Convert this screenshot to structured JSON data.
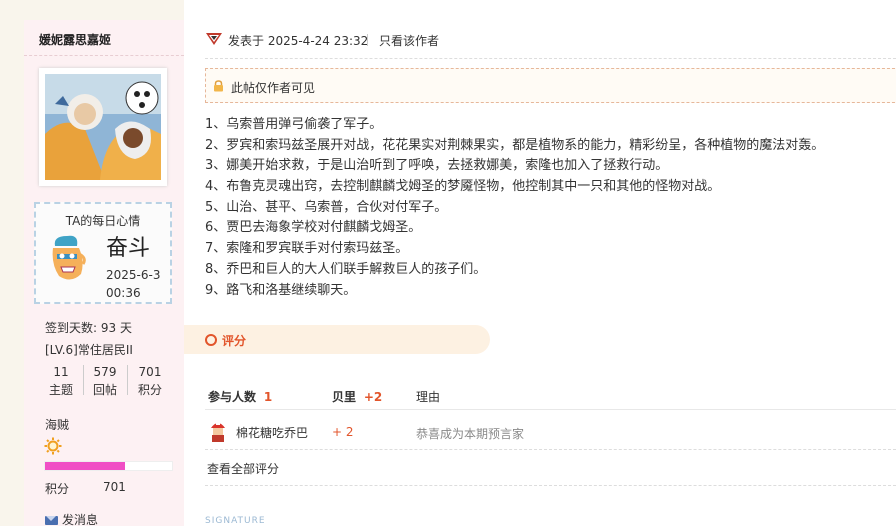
{
  "author": {
    "username": "媛妮露思嘉姬",
    "mood_title": "TA的每日心情",
    "mood_text": "奋斗",
    "mood_date": "2025-6-3",
    "mood_time": "00:36",
    "signin": "签到天数: 93 天",
    "level": "[LV.6]常住居民II",
    "stats": [
      {
        "value": "11",
        "label": "主题"
      },
      {
        "value": "579",
        "label": "回帖"
      },
      {
        "value": "701",
        "label": "积分"
      }
    ],
    "rank": "海贼",
    "progress": 0.63,
    "points_label": "积分",
    "points_value": "701",
    "send_message": "发消息",
    "progress_color": "#f04fc5"
  },
  "post": {
    "posted_at": "发表于 2025-4-24 23:32",
    "only_author": "只看该作者",
    "notice": "此帖仅作者可见",
    "lines": [
      "1、乌索普用弹弓偷袭了军子。",
      "2、罗宾和索玛兹圣展开对战，花花果实对荆棘果实，都是植物系的能力，精彩纷呈，各种植物的魔法对轰。",
      "3、娜美开始求救，于是山治听到了呼唤，去拯救娜美，索隆也加入了拯救行动。",
      "4、布鲁克灵魂出窍，去控制麒麟戈姆圣的梦魇怪物，他控制其中一只和其他的怪物对战。",
      "5、山治、甚平、乌索普，合伙对付军子。",
      "6、贾巴去海象学校对付麒麟戈姆圣。",
      "7、索隆和罗宾联手对付索玛兹圣。",
      "8、乔巴和巨人的大人们联手解救巨人的孩子们。",
      "9、路飞和洛基继续聊天。"
    ]
  },
  "rating": {
    "tab_label": "评分",
    "participants_label": "参与人数",
    "participants_count": "1",
    "shell_label": "贝里",
    "shell_total": "+2",
    "reason_label": "理由",
    "rows": [
      {
        "user": "棉花糖吃乔巴",
        "value": "+ 2",
        "reason": "恭喜成为本期预言家"
      }
    ],
    "view_all": "查看全部评分",
    "accent_color": "#e2552b"
  },
  "signature_label": "SIGNATURE"
}
